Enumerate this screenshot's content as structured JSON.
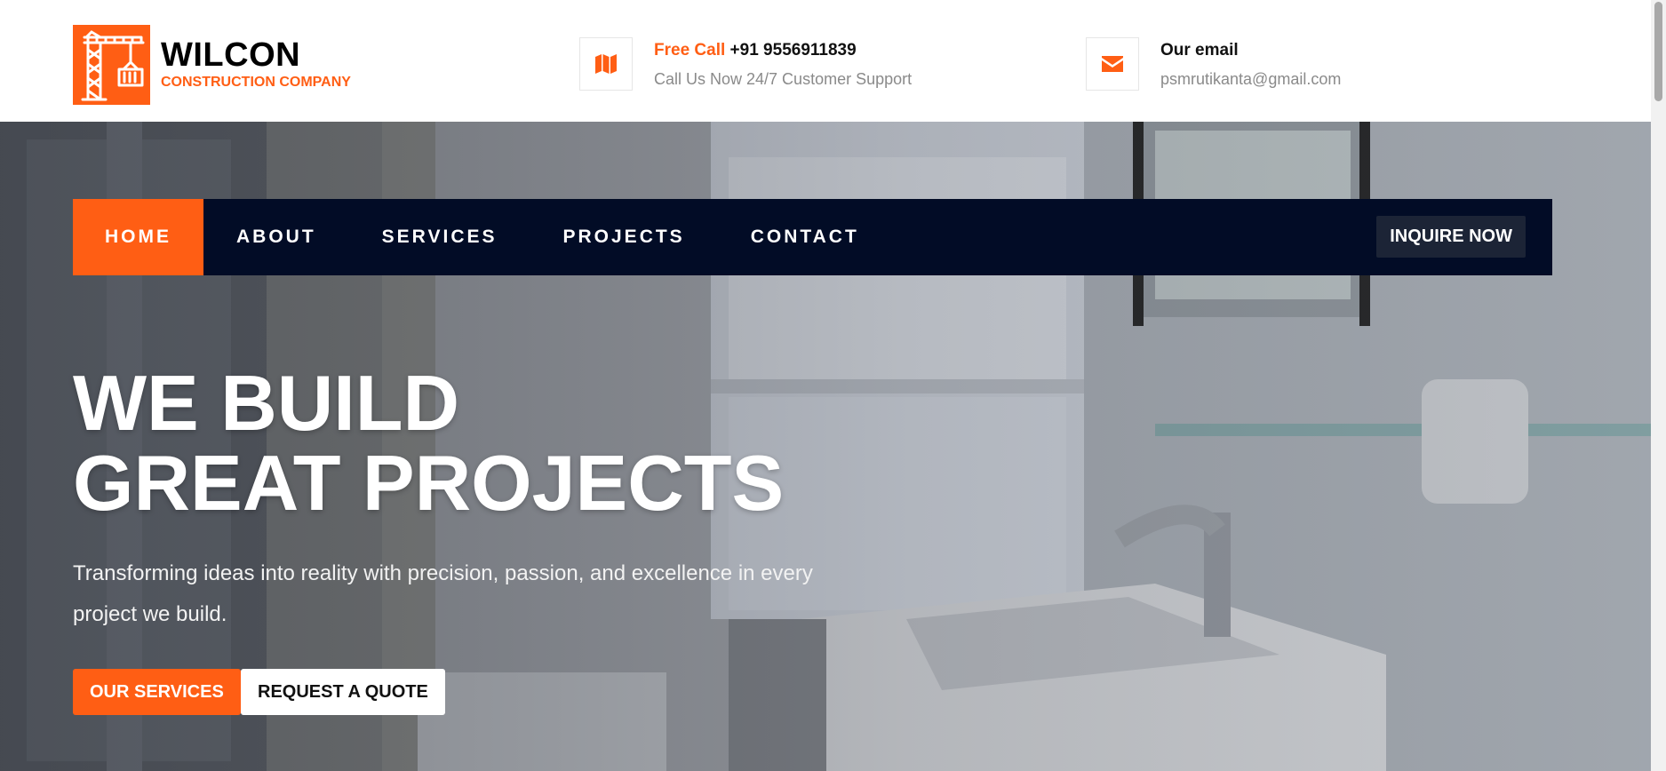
{
  "brand": {
    "name": "WILCON",
    "subtitle": "CONSTRUCTION COMPANY",
    "logo_icon": "crane-icon",
    "accent_color": "#ff5e14",
    "dark_color": "#020c26"
  },
  "contact_call": {
    "icon": "map-icon",
    "label_accent": "Free Call",
    "phone": "+91 9556911839",
    "subtext": "Call Us Now 24/7 Customer Support"
  },
  "contact_email": {
    "icon": "envelope-icon",
    "label": "Our email",
    "email": "psmrutikanta@gmail.com"
  },
  "nav": {
    "items": [
      {
        "label": "HOME",
        "active": true
      },
      {
        "label": "ABOUT",
        "active": false
      },
      {
        "label": "SERVICES",
        "active": false
      },
      {
        "label": "PROJECTS",
        "active": false
      },
      {
        "label": "CONTACT",
        "active": false
      }
    ],
    "cta_label": "INQUIRE NOW"
  },
  "hero": {
    "headline_line1": "WE BUILD",
    "headline_line2": "GREAT PROJECTS",
    "tagline": "Transforming ideas into reality with precision, passion, and excellence in every project we build.",
    "primary_button": "OUR SERVICES",
    "secondary_button": "REQUEST A QUOTE"
  }
}
